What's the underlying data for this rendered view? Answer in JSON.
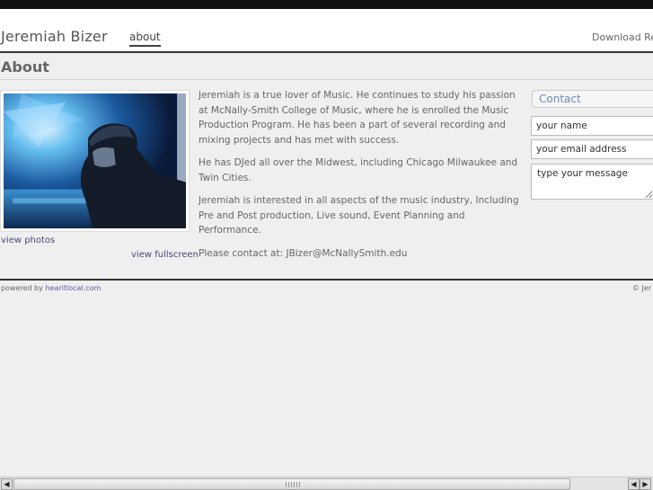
{
  "header": {
    "site_title": "Jeremiah Bizer",
    "nav_about": "about",
    "nav_download": "Download Re"
  },
  "page": {
    "heading": "About"
  },
  "photo": {
    "view_photos": "view photos",
    "view_fullscreen": "view fullscreen"
  },
  "bio": {
    "paragraphs": [
      "Jeremiah is a true lover of Music. He continues to study his passion at McNally-Smith College of Music, where he is enrolled the Music Production Program.  He has been a part of several recording and mixing projects and has met with success.",
      "He has DJed all over the Midwest, including Chicago Milwaukee and Twin Cities.",
      "Jeremiah is interested in all aspects of the music industry, Including Pre and Post production, Live sound, Event Planning and Performance.",
      "Please contact at: JBizer@McNallySmith.edu"
    ]
  },
  "contact": {
    "heading": "Contact",
    "name_value": "your name",
    "email_value": "your email address",
    "message_value": "type your message"
  },
  "footer": {
    "powered_by": "powered by ",
    "brand": "hearitlocal.com",
    "copyright": "© Jer"
  },
  "scrollbar": {
    "left_arrow": "◀",
    "right_arrow": "▶"
  },
  "colors": {
    "accent": "#7088b0",
    "link": "#4a4a7a",
    "brand": "#5a5aa0"
  },
  "icons": {
    "scroll_left": "scroll-left-arrow-icon",
    "scroll_right": "scroll-right-arrow-icon"
  }
}
